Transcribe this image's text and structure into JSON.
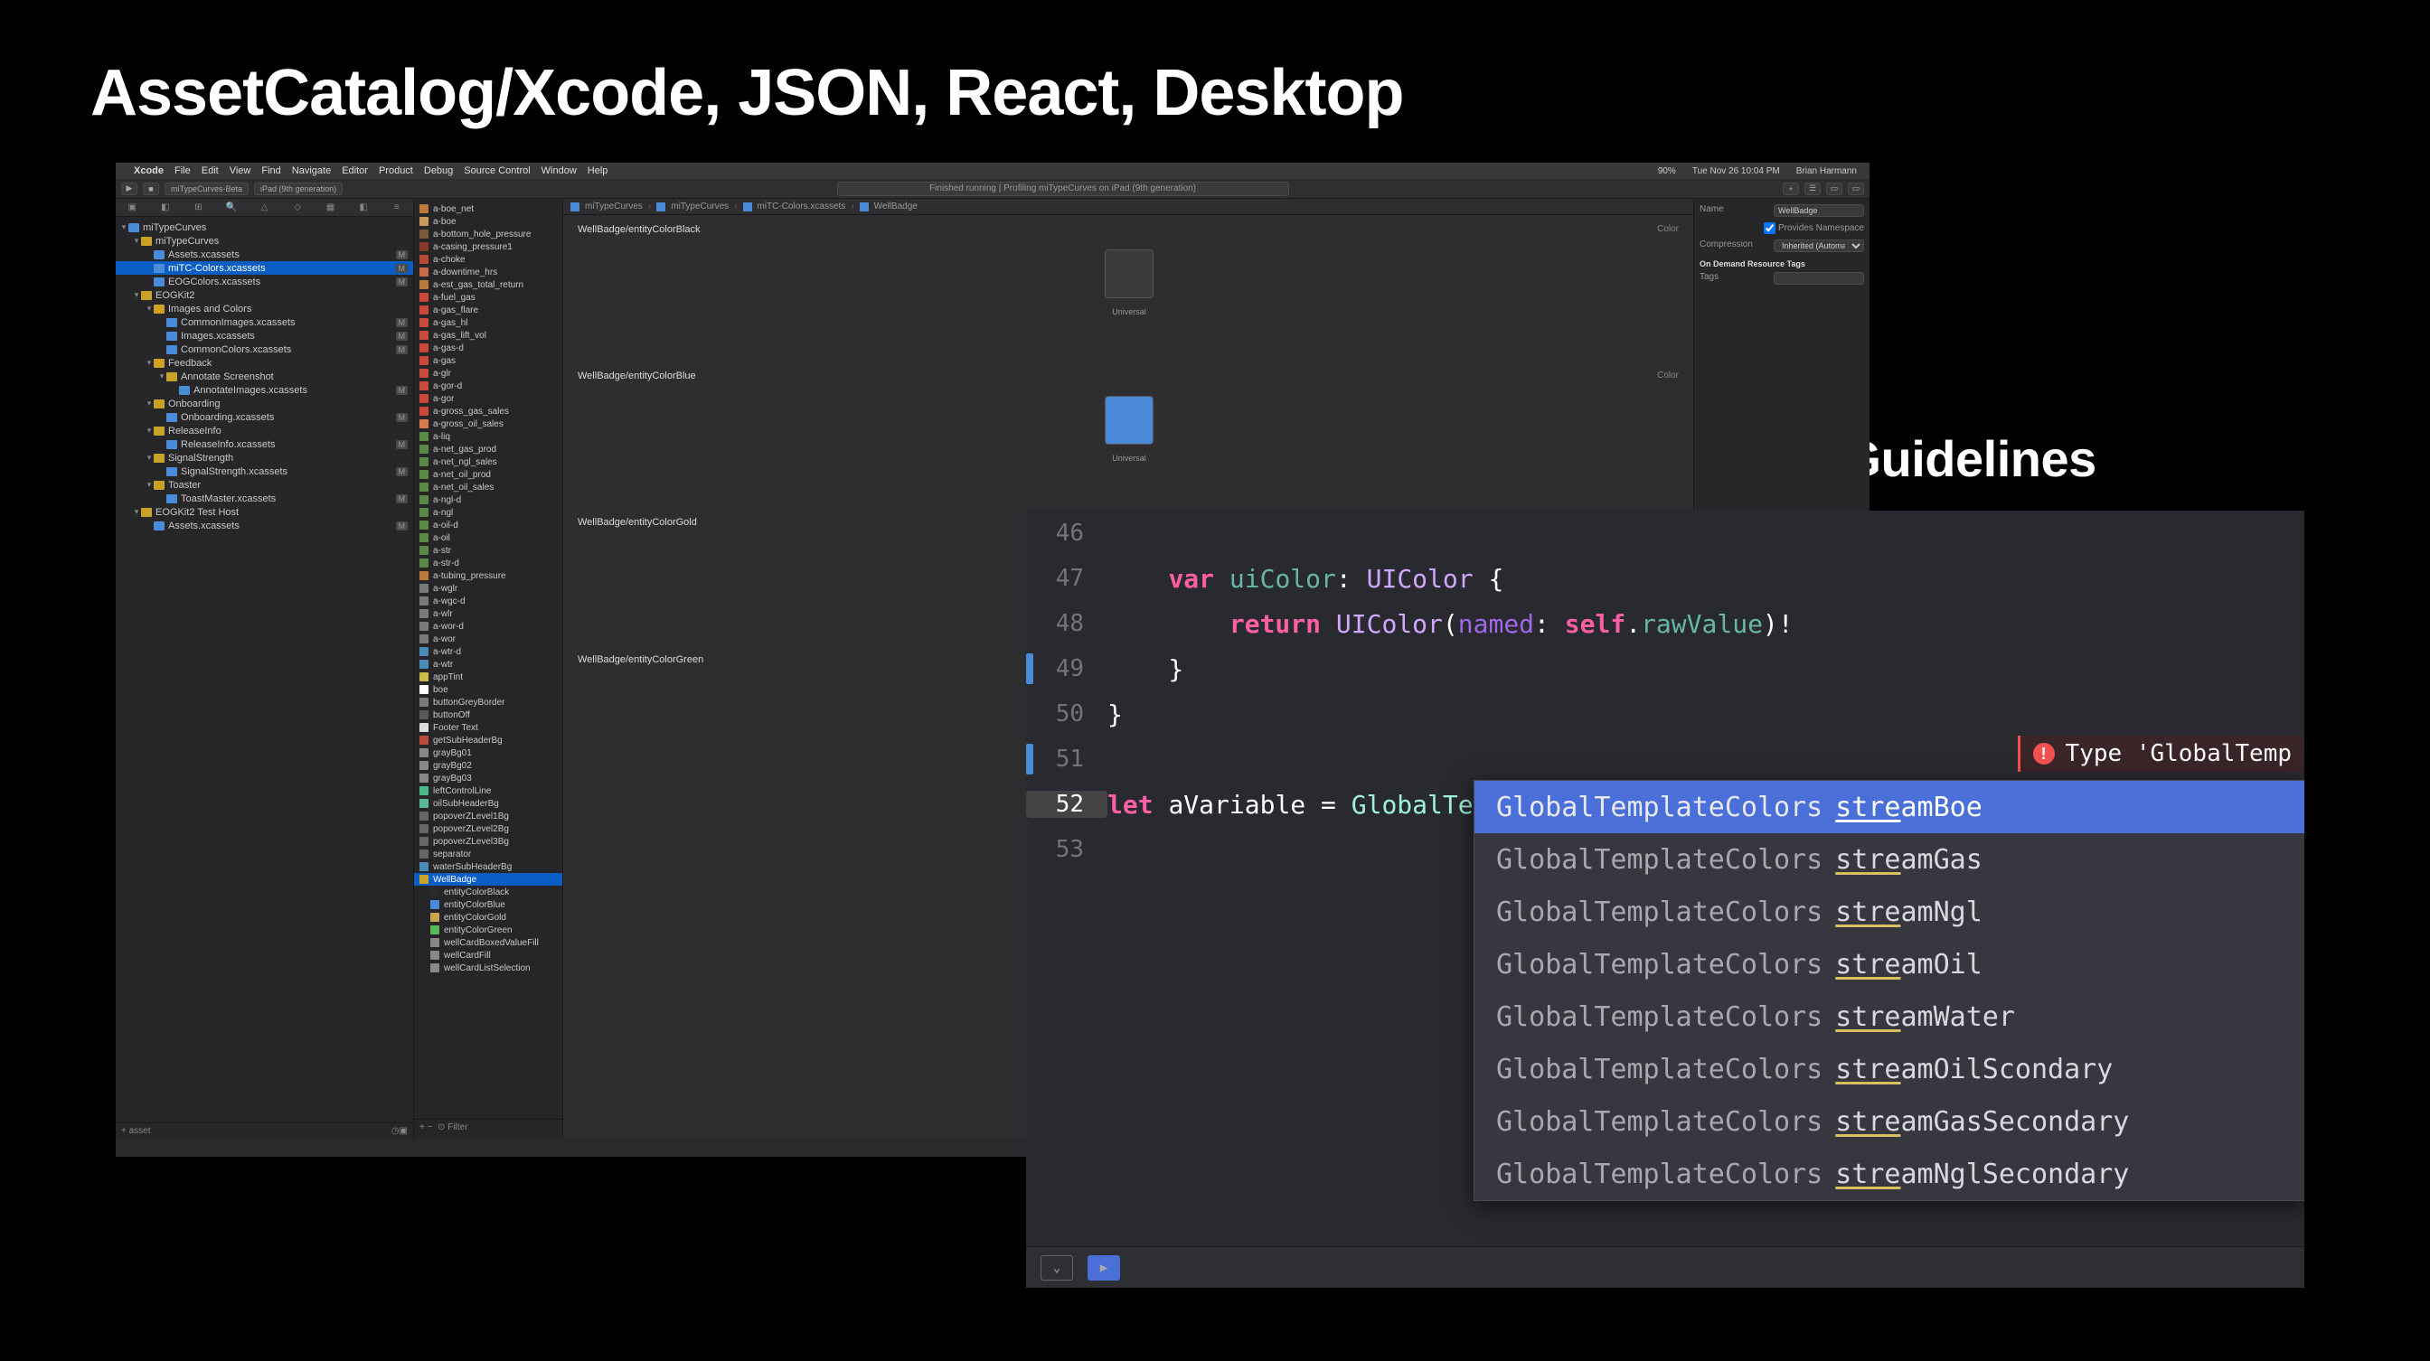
{
  "slide": {
    "title": "AssetCatalog/Xcode, JSON, React, Desktop",
    "subtitle": "Semantic Naming Guidelines"
  },
  "menubar": {
    "items": [
      "Xcode",
      "File",
      "Edit",
      "View",
      "Find",
      "Navigate",
      "Editor",
      "Product",
      "Debug",
      "Source Control",
      "Window",
      "Help"
    ],
    "status": {
      "battery": "90%",
      "date": "Tue Nov 26 10:04 PM",
      "user": "Brian Harmann"
    }
  },
  "toolbar": {
    "scheme": "miTypeCurves-Beta",
    "device": "iPad (9th generation)",
    "status": "Finished running | Profiling miTypeCurves on iPad (9th generation)"
  },
  "tabs": [
    "miTypeCurves-Beta",
    "iPad (9th generation)"
  ],
  "navTree": [
    {
      "d": 0,
      "icon": "folder-blue",
      "label": "miTypeCurves",
      "open": true
    },
    {
      "d": 1,
      "icon": "folder-yellow",
      "label": "miTypeCurves",
      "open": true
    },
    {
      "d": 2,
      "icon": "asset-icon",
      "label": "Assets.xcassets",
      "tag": "M",
      "sel": false
    },
    {
      "d": 2,
      "icon": "asset-icon",
      "label": "miTC-Colors.xcassets",
      "tag": "M",
      "sel": true
    },
    {
      "d": 2,
      "icon": "asset-icon",
      "label": "EOGColors.xcassets",
      "tag": "M"
    },
    {
      "d": 1,
      "icon": "folder-yellow",
      "label": "EOGKit2",
      "open": true
    },
    {
      "d": 2,
      "icon": "folder-yellow",
      "label": "Images and Colors",
      "open": true
    },
    {
      "d": 3,
      "icon": "asset-icon",
      "label": "CommonImages.xcassets",
      "tag": "M"
    },
    {
      "d": 3,
      "icon": "asset-icon",
      "label": "Images.xcassets",
      "tag": "M"
    },
    {
      "d": 3,
      "icon": "asset-icon",
      "label": "CommonColors.xcassets",
      "tag": "M"
    },
    {
      "d": 2,
      "icon": "folder-yellow",
      "label": "Feedback",
      "open": true
    },
    {
      "d": 3,
      "icon": "folder-yellow",
      "label": "Annotate Screenshot",
      "open": true
    },
    {
      "d": 4,
      "icon": "asset-icon",
      "label": "AnnotateImages.xcassets",
      "tag": "M"
    },
    {
      "d": 2,
      "icon": "folder-yellow",
      "label": "Onboarding",
      "open": true
    },
    {
      "d": 3,
      "icon": "asset-icon",
      "label": "Onboarding.xcassets",
      "tag": "M"
    },
    {
      "d": 2,
      "icon": "folder-yellow",
      "label": "ReleaseInfo",
      "open": true
    },
    {
      "d": 3,
      "icon": "asset-icon",
      "label": "ReleaseInfo.xcassets",
      "tag": "M"
    },
    {
      "d": 2,
      "icon": "folder-yellow",
      "label": "SignalStrength",
      "open": true
    },
    {
      "d": 3,
      "icon": "asset-icon",
      "label": "SignalStrength.xcassets",
      "tag": "M"
    },
    {
      "d": 2,
      "icon": "folder-yellow",
      "label": "Toaster",
      "open": true
    },
    {
      "d": 3,
      "icon": "asset-icon",
      "label": "ToastMaster.xcassets",
      "tag": "M"
    },
    {
      "d": 1,
      "icon": "folder-yellow",
      "label": "EOGKit2 Test Host",
      "open": true
    },
    {
      "d": 2,
      "icon": "asset-icon",
      "label": "Assets.xcassets",
      "tag": "M"
    }
  ],
  "navFilter": "asset",
  "breadcrumb": [
    "miTypeCurves",
    "miTypeCurves",
    "miTC-Colors.xcassets",
    "WellBadge"
  ],
  "assetList": [
    {
      "c": "#b97a3a",
      "l": "a-boe_net"
    },
    {
      "c": "#c99a5a",
      "l": "a-boe"
    },
    {
      "c": "#7a5a3a",
      "l": "a-bottom_hole_pressure"
    },
    {
      "c": "#8a3a2a",
      "l": "a-casing_pressure1"
    },
    {
      "c": "#b94a3a",
      "l": "a-choke"
    },
    {
      "c": "#c96a4a",
      "l": "a-downtime_hrs"
    },
    {
      "c": "#b97a3a",
      "l": "a-est_gas_total_return"
    },
    {
      "c": "#c94a3a",
      "l": "a-fuel_gas"
    },
    {
      "c": "#c94a3a",
      "l": "a-gas_flare"
    },
    {
      "c": "#c94a3a",
      "l": "a-gas_hl"
    },
    {
      "c": "#c94a3a",
      "l": "a-gas_lift_vol"
    },
    {
      "c": "#c94a3a",
      "l": "a-gas-d"
    },
    {
      "c": "#c94a3a",
      "l": "a-gas"
    },
    {
      "c": "#c94a3a",
      "l": "a-glr"
    },
    {
      "c": "#c94a3a",
      "l": "a-gor-d"
    },
    {
      "c": "#c94a3a",
      "l": "a-gor"
    },
    {
      "c": "#c94a3a",
      "l": "a-gross_gas_sales"
    },
    {
      "c": "#d97a4a",
      "l": "a-gross_oil_sales"
    },
    {
      "c": "#5a8a4a",
      "l": "a-liq"
    },
    {
      "c": "#5a8a4a",
      "l": "a-net_gas_prod"
    },
    {
      "c": "#5a8a4a",
      "l": "a-net_ngl_sales"
    },
    {
      "c": "#5a8a4a",
      "l": "a-net_oil_prod"
    },
    {
      "c": "#5a8a4a",
      "l": "a-net_oil_sales"
    },
    {
      "c": "#5a8a4a",
      "l": "a-ngl-d"
    },
    {
      "c": "#5a8a4a",
      "l": "a-ngl"
    },
    {
      "c": "#5a8a4a",
      "l": "a-oil-d"
    },
    {
      "c": "#5a8a4a",
      "l": "a-oil"
    },
    {
      "c": "#5a8a4a",
      "l": "a-str"
    },
    {
      "c": "#5a8a4a",
      "l": "a-str-d"
    },
    {
      "c": "#b97a3a",
      "l": "a-tubing_pressure"
    },
    {
      "c": "#7a7a7a",
      "l": "a-wglr"
    },
    {
      "c": "#7a7a7a",
      "l": "a-wgc-d"
    },
    {
      "c": "#7a7a7a",
      "l": "a-wlr"
    },
    {
      "c": "#7a7a7a",
      "l": "a-wor-d"
    },
    {
      "c": "#7a7a7a",
      "l": "a-wor"
    },
    {
      "c": "#4a8ab8",
      "l": "a-wtr-d"
    },
    {
      "c": "#4a8ab8",
      "l": "a-wtr"
    },
    {
      "c": "#c9b84a",
      "l": "appTint"
    },
    {
      "c": "#ffffff",
      "l": "boe"
    },
    {
      "c": "#7a7a7a",
      "l": "buttonGreyBorder"
    },
    {
      "c": "#5a5a5a",
      "l": "buttonOff"
    },
    {
      "c": "#ddd",
      "l": "Footer Text"
    },
    {
      "c": "#b94a3a",
      "l": "getSubHeaderBg"
    },
    {
      "c": "#888",
      "l": "grayBg01"
    },
    {
      "c": "#888",
      "l": "grayBg02"
    },
    {
      "c": "#888",
      "l": "grayBg03"
    },
    {
      "c": "#4ab88a",
      "l": "leftControlLine"
    },
    {
      "c": "#5ab89a",
      "l": "oilSubHeaderBg"
    },
    {
      "c": "#666",
      "l": "popoverZLevel1Bg"
    },
    {
      "c": "#666",
      "l": "popoverZLevel2Bg"
    },
    {
      "c": "#666",
      "l": "popoverZLevel3Bg"
    },
    {
      "c": "#666",
      "l": "separator"
    },
    {
      "c": "#4a8ab8",
      "l": "waterSubHeaderBg"
    },
    {
      "c": "#fff",
      "l": "WellBadge",
      "sel": true,
      "folder": true
    },
    {
      "c": "#2a2a2a",
      "l": "entityColorBlack",
      "indent": true
    },
    {
      "c": "#4a8ad8",
      "l": "entityColorBlue",
      "indent": true
    },
    {
      "c": "#c9a84a",
      "l": "entityColorGold",
      "indent": true
    },
    {
      "c": "#5ab85a",
      "l": "entityColorGreen",
      "indent": true
    },
    {
      "c": "#888",
      "l": "wellCardBoxedValueFill",
      "indent": true
    },
    {
      "c": "#888",
      "l": "wellCardFill",
      "indent": true
    },
    {
      "c": "#888",
      "l": "wellCardListSelection",
      "indent": true
    }
  ],
  "assetFilter": "Filter",
  "canvasGroups": [
    {
      "title": "WellBadge/entityColorBlack",
      "right": "Color",
      "swatch": "#3a3a3c",
      "label": "Universal"
    },
    {
      "title": "WellBadge/entityColorBlue",
      "right": "Color",
      "swatch": "#4a8ad8",
      "label": "Universal"
    },
    {
      "title": "WellBadge/entityColorGold",
      "right": "Color",
      "swatch": "#e8c850",
      "label": ""
    },
    {
      "title": "WellBadge/entityColorGreen",
      "right": "Color",
      "swatch": "",
      "label": ""
    }
  ],
  "inspector": {
    "name_label": "Name",
    "name_value": "WellBadge",
    "provides": "Provides Namespace",
    "compression_label": "Compression",
    "compression_value": "Inherited (Automatic)",
    "odrt": "On Demand Resource Tags",
    "tags": "Tags"
  },
  "code": {
    "lines": [
      {
        "n": "46",
        "t": ""
      },
      {
        "n": "47",
        "t": "    var uiColor: UIColor {",
        "tokens": [
          [
            "    ",
            ""
          ],
          [
            "var",
            "kw"
          ],
          [
            " ",
            ""
          ],
          [
            "uiColor",
            "ident"
          ],
          [
            ": ",
            "plain"
          ],
          [
            "UIColor",
            "type2"
          ],
          [
            " {",
            "plain"
          ]
        ]
      },
      {
        "n": "48",
        "t": "        return UIColor(named: self.rawValue)!",
        "tokens": [
          [
            "        ",
            ""
          ],
          [
            "return",
            "kw"
          ],
          [
            " ",
            ""
          ],
          [
            "UIColor",
            "type2"
          ],
          [
            "(",
            "plain"
          ],
          [
            "named",
            "func"
          ],
          [
            ": ",
            "plain"
          ],
          [
            "self",
            "kw"
          ],
          [
            ".",
            "plain"
          ],
          [
            "rawValue",
            "prop"
          ],
          [
            ")",
            "plain"
          ],
          [
            "!",
            "plain"
          ]
        ]
      },
      {
        "n": "49",
        "t": "    }",
        "mark": true,
        "tokens": [
          [
            "    }",
            "plain"
          ]
        ]
      },
      {
        "n": "50",
        "t": "}",
        "tokens": [
          [
            "}",
            "plain"
          ]
        ]
      },
      {
        "n": "51",
        "t": "",
        "mark": true
      },
      {
        "n": "52",
        "t": "let aVariable = GlobalTemplateColors.stre",
        "hl": true,
        "tokens": [
          [
            "let",
            "kw"
          ],
          [
            " ",
            ""
          ],
          [
            "aVariable",
            "plain"
          ],
          [
            " = ",
            "plain"
          ],
          [
            "GlobalTemplateColors",
            "type"
          ],
          [
            ".",
            "plain"
          ],
          [
            "stre",
            "partial"
          ]
        ]
      },
      {
        "n": "53",
        "t": ""
      }
    ],
    "error": "Type 'GlobalTemp"
  },
  "autocomplete": [
    {
      "type": "GlobalTemplateColors",
      "name": "streamBoe",
      "sel": true
    },
    {
      "type": "GlobalTemplateColors",
      "name": "streamGas"
    },
    {
      "type": "GlobalTemplateColors",
      "name": "streamNgl"
    },
    {
      "type": "GlobalTemplateColors",
      "name": "streamOil"
    },
    {
      "type": "GlobalTemplateColors",
      "name": "streamWater"
    },
    {
      "type": "GlobalTemplateColors",
      "name": "streamOilScondary"
    },
    {
      "type": "GlobalTemplateColors",
      "name": "streamGasSecondary"
    },
    {
      "type": "GlobalTemplateColors",
      "name": "streamNglSecondary"
    }
  ]
}
